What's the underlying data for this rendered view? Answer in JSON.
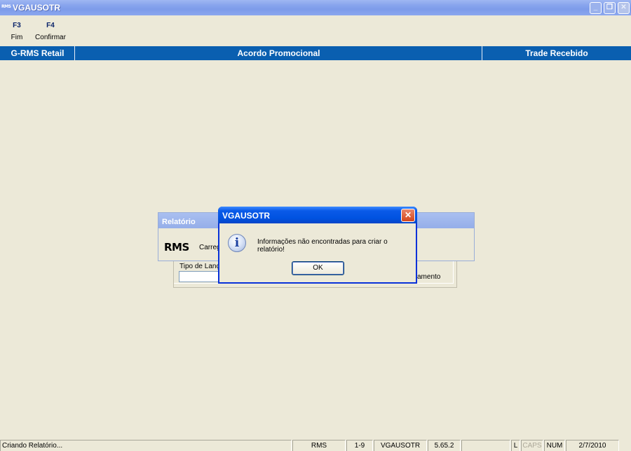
{
  "window": {
    "icon_text": "RMS",
    "title": "VGAUSOTR",
    "minimize": "_",
    "restore": "❐",
    "close": "✕"
  },
  "toolbar": {
    "items": [
      {
        "key": "F3",
        "label": "Fim"
      },
      {
        "key": "F4",
        "label": "Confirmar"
      }
    ]
  },
  "header": {
    "left": "G-RMS Retail",
    "center": "Acordo Promocional",
    "right": "Trade Recebido"
  },
  "report_window": {
    "title": "Relatório",
    "logo": "RMS",
    "status_text": "Carreg",
    "field_label": "Tipo de Lanç",
    "field_value": "",
    "partial_label": "amento"
  },
  "dialog": {
    "title": "VGAUSOTR",
    "close": "✕",
    "icon": "i",
    "message": "Informações não encontradas para criar o relatório!",
    "ok_label": "OK"
  },
  "statusbar": {
    "message": "Criando Relatório...",
    "system": "RMS",
    "range": "1-9",
    "program": "VGAUSOTR",
    "version": "5.65.2",
    "blank": "",
    "l": "L",
    "caps": "CAPS",
    "num": "NUM",
    "date": "2/7/2010"
  },
  "colors": {
    "header_blue": "#0a5fb0",
    "dialog_border": "#0831d9",
    "background": "#ece9d8"
  }
}
